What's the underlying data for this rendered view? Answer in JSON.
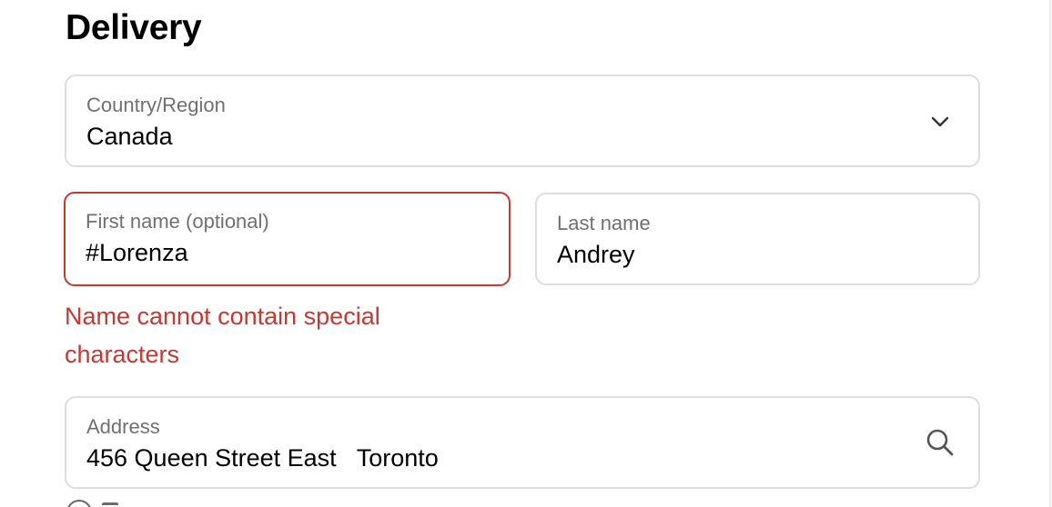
{
  "section": {
    "title": "Delivery"
  },
  "country_field": {
    "label": "Country/Region",
    "value": "Canada",
    "icon": "chevron-down-icon"
  },
  "first_name_field": {
    "label": "First name (optional)",
    "value": "#Lorenza",
    "state": "error",
    "error_message": "Name cannot contain special characters"
  },
  "last_name_field": {
    "label": "Last name",
    "value": "Andrey"
  },
  "address_field": {
    "label": "Address",
    "value": "456 Queen Street East   Toronto",
    "icon": "search-icon"
  },
  "colors": {
    "error": "#c43a32",
    "border": "#dedede",
    "label": "#707070",
    "text": "#000000"
  }
}
